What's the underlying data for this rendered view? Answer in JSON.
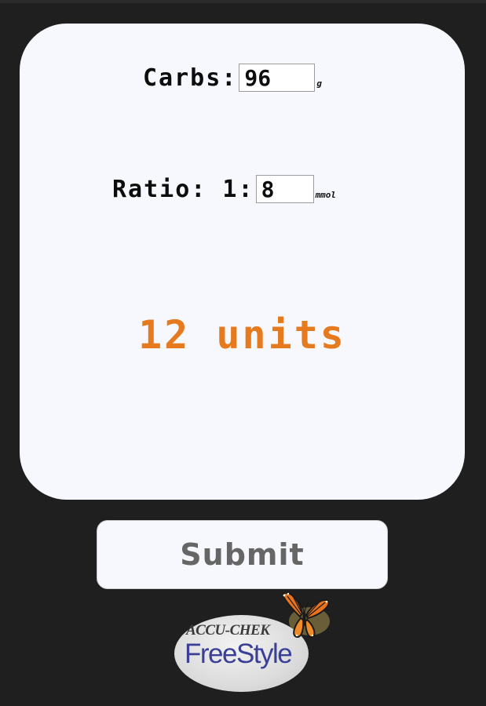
{
  "form": {
    "carbs_label": "Carbs:",
    "carbs_value": "96",
    "carbs_unit": "g",
    "ratio_label": "Ratio: 1:",
    "ratio_value": "8",
    "ratio_unit": "mmol"
  },
  "result": {
    "text": "12 units"
  },
  "submit": {
    "label": "Submit"
  },
  "logo": {
    "brand": "ACCU-CHEK",
    "product": "FreeStyle",
    "icon": "butterfly-icon"
  },
  "colors": {
    "background": "#1f1f1f",
    "card": "#f7f8fd",
    "result": "#e67a1f",
    "button_text": "#666666",
    "product_text": "#3b3f97"
  }
}
